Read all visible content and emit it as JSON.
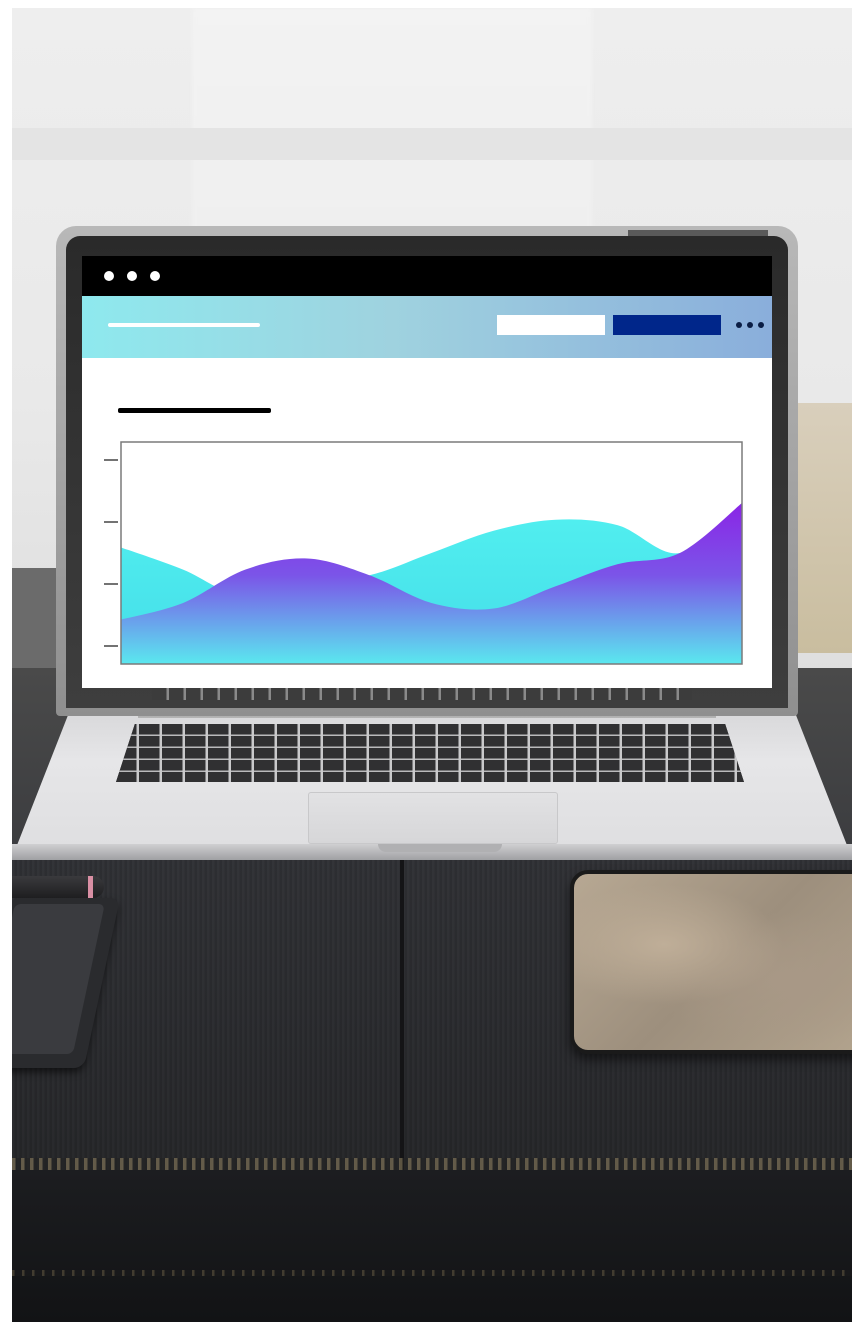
{
  "window": {
    "titlebar_dots": 3
  },
  "appbar": {
    "title": "",
    "buttons": [
      {
        "label": "",
        "style": "white"
      },
      {
        "label": "",
        "style": "navy"
      }
    ],
    "more_icon": "more-horizontal-icon"
  },
  "page": {
    "heading": ""
  },
  "colors": {
    "titlebar": "#000000",
    "appbar_start": "#8ee9ee",
    "appbar_end": "#8aaedb",
    "navy_button": "#00268a",
    "series_cyan": "#55eef0",
    "series_purple_top": "#8a2be8",
    "series_purple_bottom": "#5ee8ef",
    "plot_border": "#7a7a7a"
  },
  "chart_data": {
    "type": "area",
    "title": "",
    "xlabel": "",
    "ylabel": "",
    "y_ticks": 4,
    "ylim": [
      0,
      4
    ],
    "x": [
      0,
      1,
      2,
      3,
      4,
      5,
      6,
      7,
      8,
      9,
      10
    ],
    "series": [
      {
        "values": [
          2.1,
          1.7,
          1.2,
          1.5,
          1.6,
          2.0,
          2.4,
          2.6,
          2.5,
          2.0,
          2.9
        ]
      },
      {
        "values": [
          0.8,
          1.1,
          1.7,
          1.9,
          1.6,
          1.1,
          1.0,
          1.4,
          1.8,
          2.0,
          2.9
        ]
      }
    ]
  }
}
